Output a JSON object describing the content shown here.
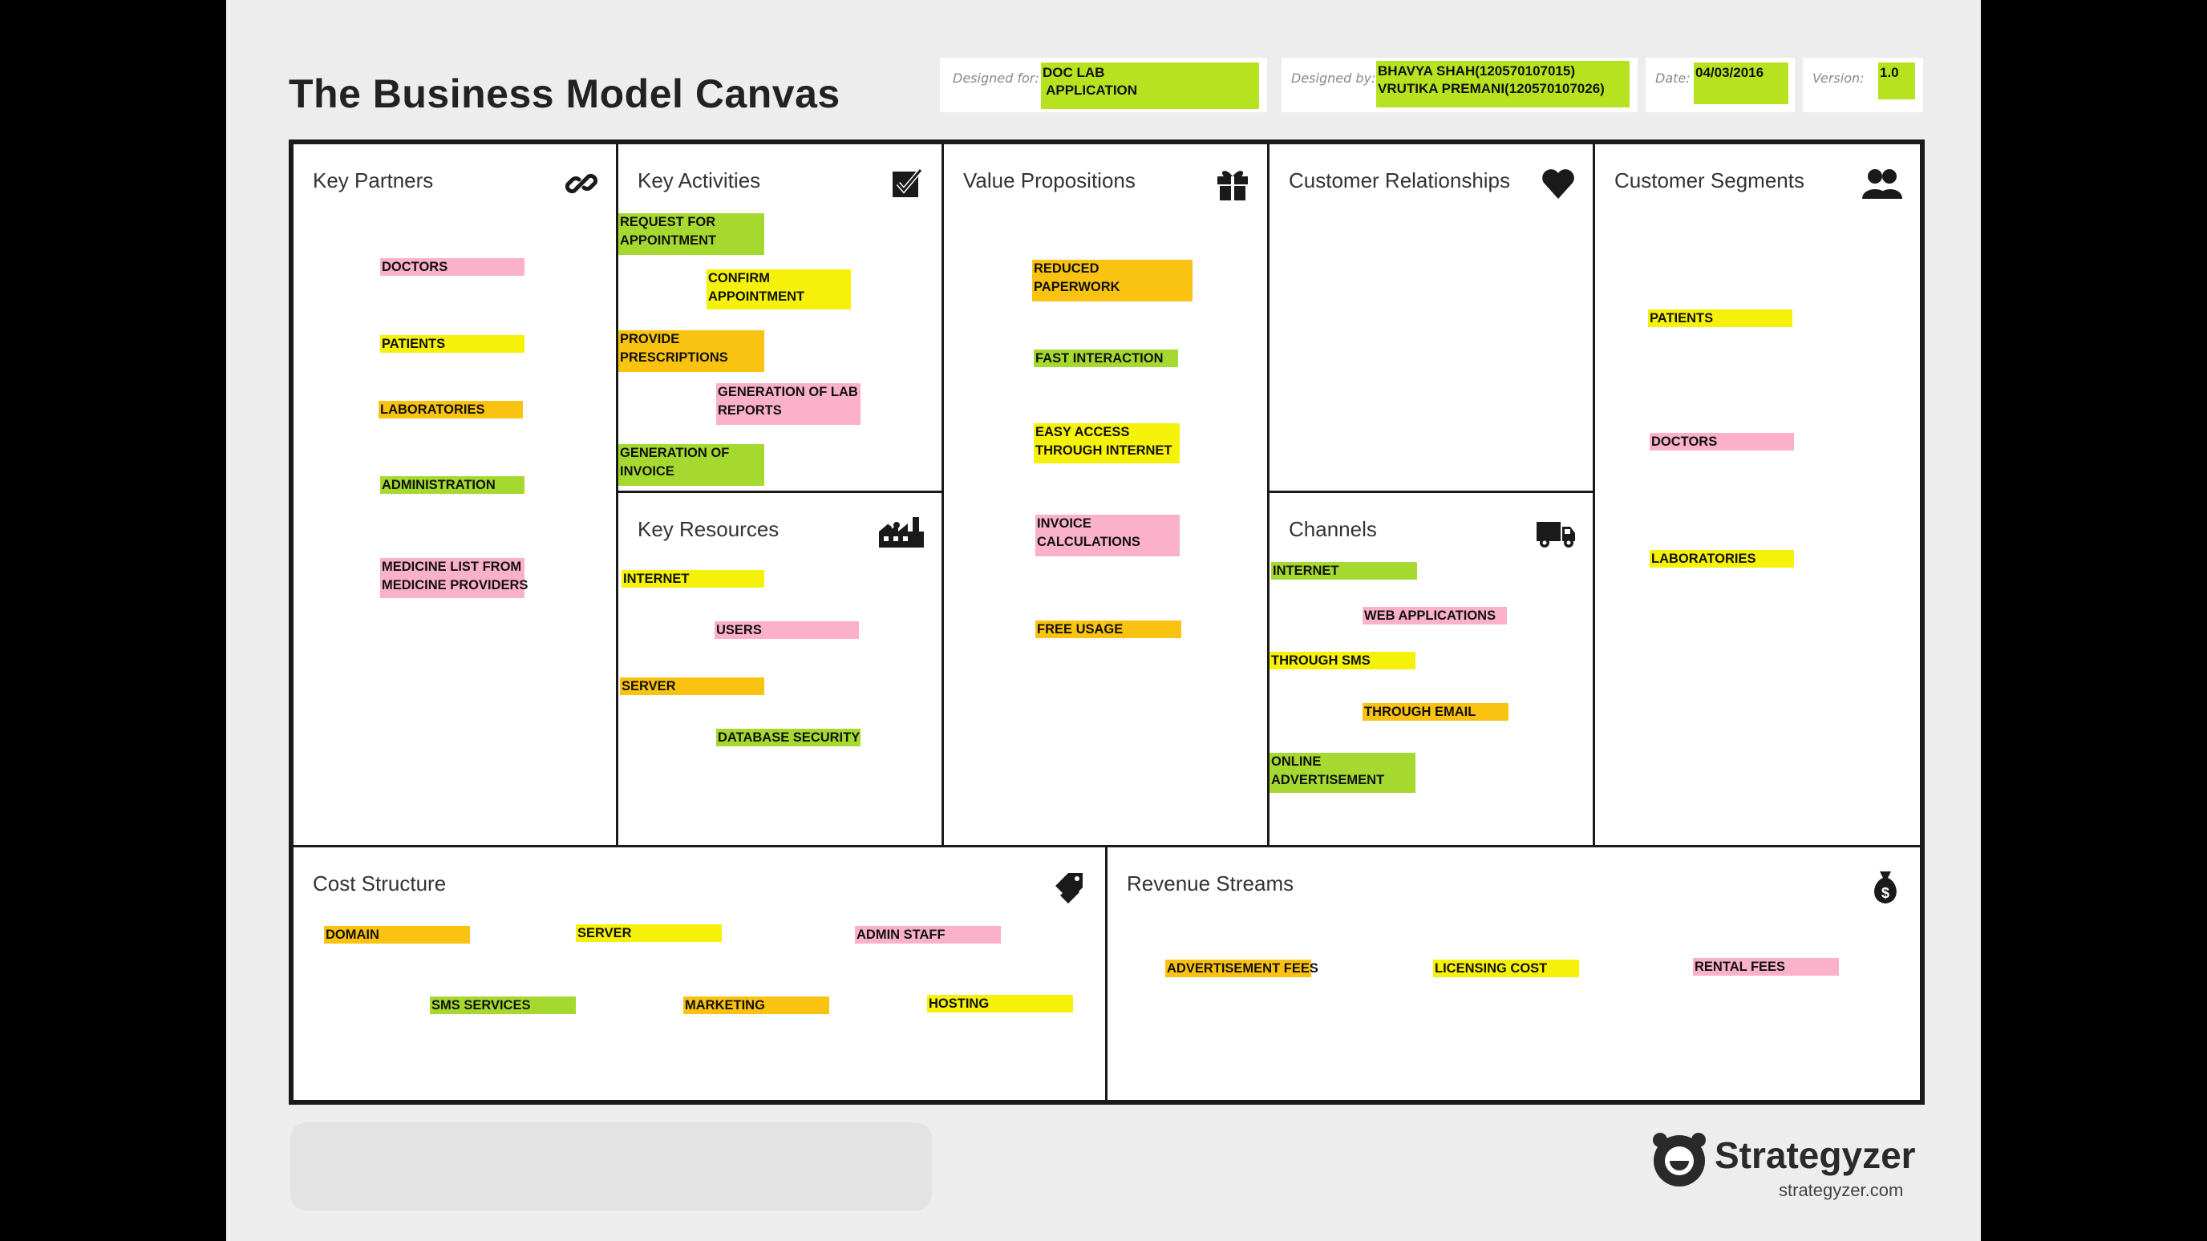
{
  "title": "The Business Model Canvas",
  "header": {
    "designed_for_label": "Designed for:",
    "designed_for_value": "DOC LAB\n APPLICATION",
    "designed_by_label": "Designed by:",
    "designed_by_value": "BHAVYA SHAH(120570107015)\nVRUTIKA PREMANI(120570107026)",
    "date_label": "Date:",
    "date_value": "04/03/2016",
    "version_label": "Version:",
    "version_value": "1.0"
  },
  "blocks": {
    "key_partners": {
      "title": "Key Partners",
      "icon": "link-icon",
      "notes": [
        {
          "text": "DOCTORS",
          "color": "pink"
        },
        {
          "text": "PATIENTS",
          "color": "yellow"
        },
        {
          "text": "LABORATORIES",
          "color": "orange"
        },
        {
          "text": "ADMINISTRATION",
          "color": "green"
        },
        {
          "text": "MEDICINE LIST FROM\nMEDICINE PROVIDERS",
          "color": "pink"
        }
      ]
    },
    "key_activities": {
      "title": "Key Activities",
      "icon": "checkbox-icon",
      "notes": [
        {
          "text": "REQUEST FOR\nAPPOINTMENT",
          "color": "green"
        },
        {
          "text": "CONFIRM\nAPPOINTMENT",
          "color": "yellow"
        },
        {
          "text": "PROVIDE\nPRESCRIPTIONS",
          "color": "orange"
        },
        {
          "text": "GENERATION OF LAB\nREPORTS",
          "color": "pink"
        },
        {
          "text": "GENERATION OF\nINVOICE",
          "color": "green"
        }
      ]
    },
    "key_resources": {
      "title": "Key Resources",
      "icon": "factory-icon",
      "notes": [
        {
          "text": "INTERNET",
          "color": "yellow"
        },
        {
          "text": "USERS",
          "color": "pink"
        },
        {
          "text": "SERVER",
          "color": "orange"
        },
        {
          "text": "DATABASE SECURITY",
          "color": "green"
        }
      ]
    },
    "value_propositions": {
      "title": "Value Propositions",
      "icon": "gift-icon",
      "notes": [
        {
          "text": "REDUCED\nPAPERWORK",
          "color": "orange"
        },
        {
          "text": "FAST INTERACTION",
          "color": "green"
        },
        {
          "text": "EASY ACCESS\nTHROUGH INTERNET",
          "color": "yellow"
        },
        {
          "text": "INVOICE\nCALCULATIONS",
          "color": "pink"
        },
        {
          "text": "FREE USAGE",
          "color": "orange"
        }
      ]
    },
    "customer_relationships": {
      "title": "Customer Relationships",
      "icon": "heart-icon",
      "notes": []
    },
    "channels": {
      "title": "Channels",
      "icon": "truck-icon",
      "notes": [
        {
          "text": "INTERNET",
          "color": "green"
        },
        {
          "text": "WEB APPLICATIONS",
          "color": "pink"
        },
        {
          "text": "THROUGH SMS",
          "color": "yellow"
        },
        {
          "text": "THROUGH EMAIL",
          "color": "orange"
        },
        {
          "text": "ONLINE\nADVERTISEMENT",
          "color": "green"
        }
      ]
    },
    "customer_segments": {
      "title": "Customer Segments",
      "icon": "users-icon",
      "notes": [
        {
          "text": "PATIENTS",
          "color": "yellow"
        },
        {
          "text": "DOCTORS",
          "color": "pink"
        },
        {
          "text": "LABORATORIES",
          "color": "yellow"
        }
      ]
    },
    "cost_structure": {
      "title": "Cost Structure",
      "icon": "price-tag-icon",
      "notes": [
        {
          "text": "DOMAIN",
          "color": "orange"
        },
        {
          "text": "SERVER",
          "color": "yellow"
        },
        {
          "text": "ADMIN STAFF",
          "color": "pink"
        },
        {
          "text": "SMS SERVICES",
          "color": "green"
        },
        {
          "text": "MARKETING",
          "color": "orange"
        },
        {
          "text": "HOSTING",
          "color": "yellow"
        }
      ]
    },
    "revenue_streams": {
      "title": "Revenue Streams",
      "icon": "money-bag-icon",
      "notes": [
        {
          "text": "ADVERTISEMENT FEES",
          "color": "orange"
        },
        {
          "text": "LICENSING COST",
          "color": "yellow"
        },
        {
          "text": "RENTAL FEES",
          "color": "pink"
        }
      ]
    }
  },
  "brand": {
    "name": "Strategyzer",
    "url": "strategyzer.com",
    "icon": "strategyzer-logo-icon"
  },
  "colors": {
    "pink": "#fbb1c9",
    "yellow": "#f6f108",
    "orange": "#fbc311",
    "green": "#a6d92f"
  }
}
